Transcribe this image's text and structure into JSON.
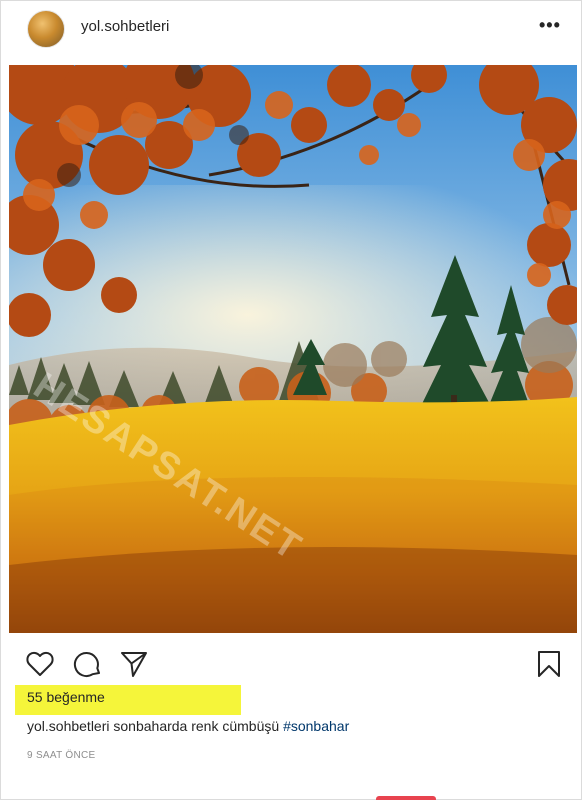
{
  "post": {
    "username": "yol.sohbetleri",
    "more_glyph": "•••",
    "image_alt": "autumn meadow with orange trees and blue sky",
    "watermark": "HESAPSAT.NET",
    "likes": "55 beğenme",
    "caption_user": "yol.sohbetleri",
    "caption_text": " sonbaharda renk cümbüşü ",
    "caption_hashtag": "#sonbahar",
    "timestamp": "9 SAAT ÖNCE"
  },
  "icons": {
    "like": "heart-icon",
    "comment": "comment-icon",
    "share": "send-icon",
    "save": "bookmark-icon",
    "more": "more-options-icon"
  },
  "colors": {
    "highlight": "#f5f53a",
    "hashtag": "#00376b",
    "muted": "#8e8e8e"
  }
}
